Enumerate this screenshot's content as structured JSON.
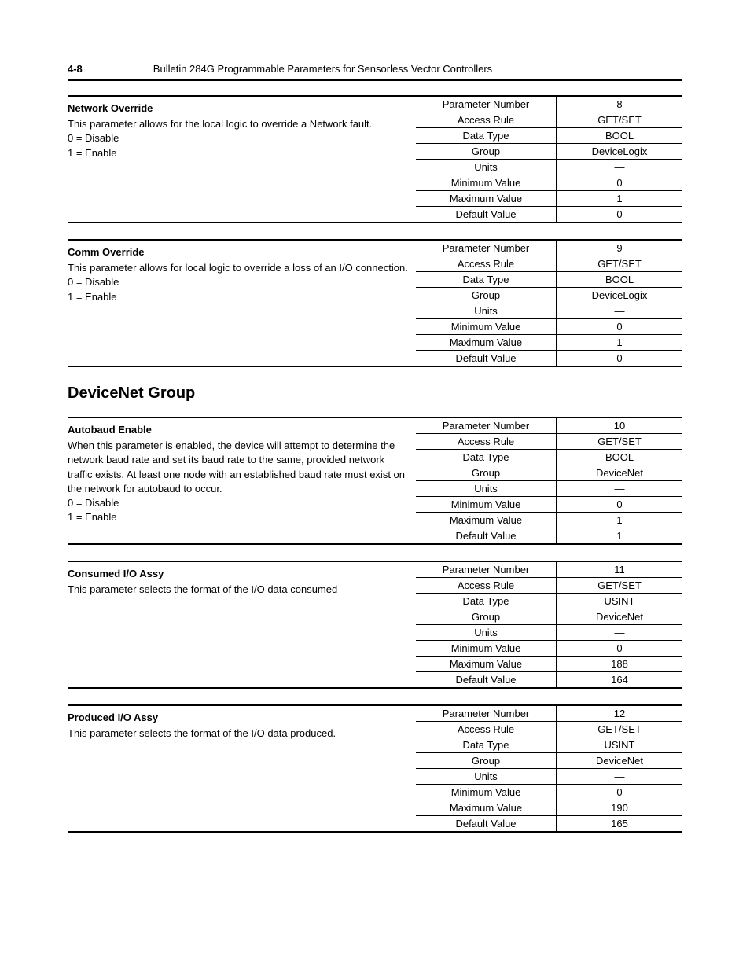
{
  "header": {
    "page_num": "4-8",
    "doc_title": "Bulletin 284G Programmable Parameters for Sensorless Vector Controllers"
  },
  "row_labels": {
    "param_num": "Parameter Number",
    "access": "Access Rule",
    "dtype": "Data Type",
    "group": "Group",
    "units": "Units",
    "min": "Minimum Value",
    "max": "Maximum Value",
    "default": "Default Value"
  },
  "sections": [
    {
      "heading": null,
      "params": [
        {
          "name": "Network Override",
          "desc_lines": [
            "This parameter allows for the local logic to override a Network fault.",
            "0 = Disable",
            "1 = Enable"
          ],
          "values": {
            "param_num": "8",
            "access": "GET/SET",
            "dtype": "BOOL",
            "group": "DeviceLogix",
            "units": "—",
            "min": "0",
            "max": "1",
            "default": "0"
          }
        },
        {
          "name": "Comm Override",
          "desc_lines": [
            "This parameter allows for local logic to override a loss of an I/O connection.",
            "0 = Disable",
            "1 = Enable"
          ],
          "values": {
            "param_num": "9",
            "access": "GET/SET",
            "dtype": "BOOL",
            "group": "DeviceLogix",
            "units": "—",
            "min": "0",
            "max": "1",
            "default": "0"
          }
        }
      ]
    },
    {
      "heading": "DeviceNet Group",
      "params": [
        {
          "name": "Autobaud Enable",
          "desc_lines": [
            "When this parameter is enabled, the device will attempt to determine the network baud rate and set its baud rate to the same, provided network traffic exists. At least one node with an established baud rate must exist on the network for autobaud to occur.",
            "0 = Disable",
            "1 = Enable"
          ],
          "values": {
            "param_num": "10",
            "access": "GET/SET",
            "dtype": "BOOL",
            "group": "DeviceNet",
            "units": "—",
            "min": "0",
            "max": "1",
            "default": "1"
          }
        },
        {
          "name": "Consumed I/O Assy",
          "desc_lines": [
            "This parameter selects the format of the I/O data consumed"
          ],
          "values": {
            "param_num": "11",
            "access": "GET/SET",
            "dtype": "USINT",
            "group": "DeviceNet",
            "units": "—",
            "min": "0",
            "max": "188",
            "default": "164"
          }
        },
        {
          "name": "Produced I/O Assy",
          "desc_lines": [
            "This parameter selects the format of the I/O data produced."
          ],
          "values": {
            "param_num": "12",
            "access": "GET/SET",
            "dtype": "USINT",
            "group": "DeviceNet",
            "units": "—",
            "min": "0",
            "max": "190",
            "default": "165"
          }
        }
      ]
    }
  ]
}
